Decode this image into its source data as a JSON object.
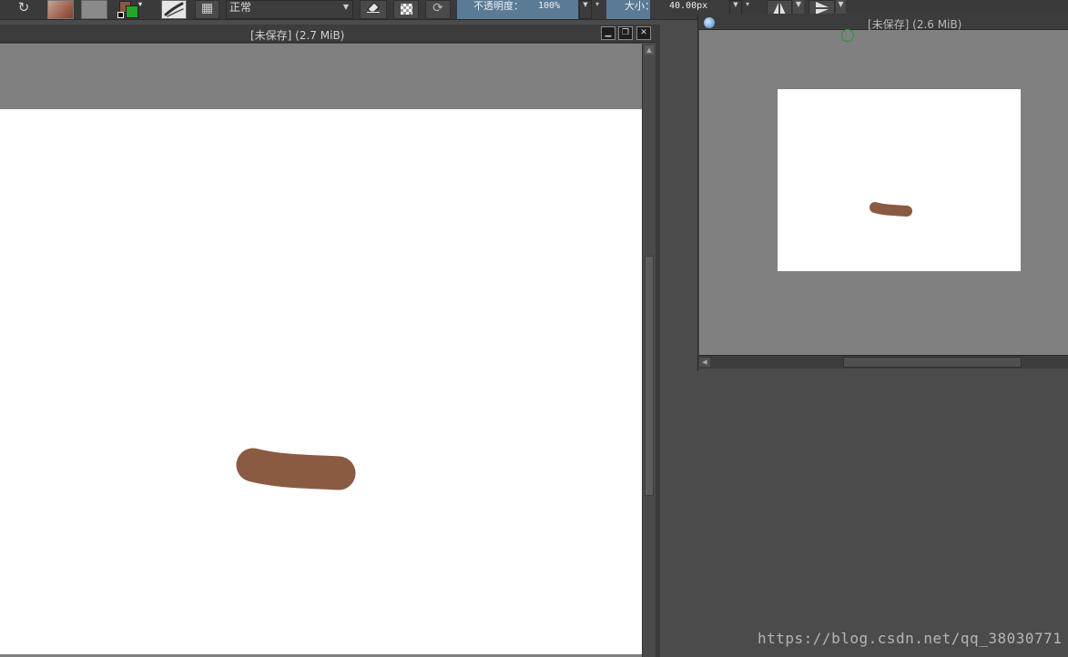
{
  "toolbar": {
    "undo_icon": "redo-icon",
    "blend_mode": "正常",
    "opacity_label": "不透明度：",
    "opacity_value": "100%",
    "opacity": 1.0,
    "size_label": "大小：",
    "size_value": "40.00px",
    "foreground_color": "#25a527",
    "background_color": "#8b5843"
  },
  "main_window": {
    "title": "[未保存]  (2.7 MiB)",
    "stroke_color": "#8b5a43",
    "controls": [
      "minimize",
      "restore",
      "close"
    ]
  },
  "overview_window": {
    "title": "[未保存]  (2.6 MiB)",
    "stroke_color": "#8b5a43"
  },
  "watermark": "https://blog.csdn.net/qq_38030771",
  "colors": {
    "toolbar_bg": "#3a3a3a",
    "accent_blue": "#5a7a96",
    "canvas_gray": "#808080",
    "workspace": "#4b4b4b"
  }
}
